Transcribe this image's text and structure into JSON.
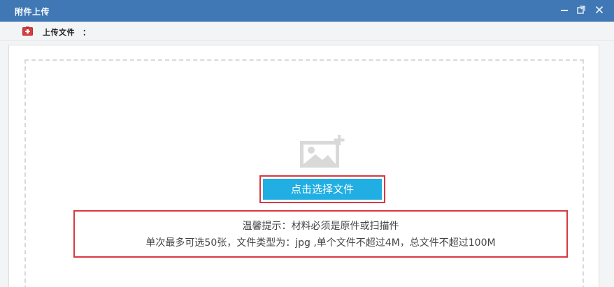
{
  "window": {
    "title": "附件上传",
    "minimize_icon": "minimize-icon",
    "maximize_icon": "restore-icon",
    "close_icon": "close-icon",
    "title_bar_color": "#3f78b5"
  },
  "toolbar": {
    "upload_label": "上传文件",
    "colon": "：",
    "icon": "upload-file-icon"
  },
  "dropzone": {
    "image_icon": "image-add-icon",
    "choose_button_label": "点击选择文件",
    "button_color": "#20aee3",
    "highlight_color": "#d8383f",
    "tips": {
      "line1": "温馨提示：材料必须是原件或扫描件",
      "line2": "单次最多可选50张，文件类型为：jpg ,单个文件不超过4M，总文件不超过100M"
    }
  }
}
